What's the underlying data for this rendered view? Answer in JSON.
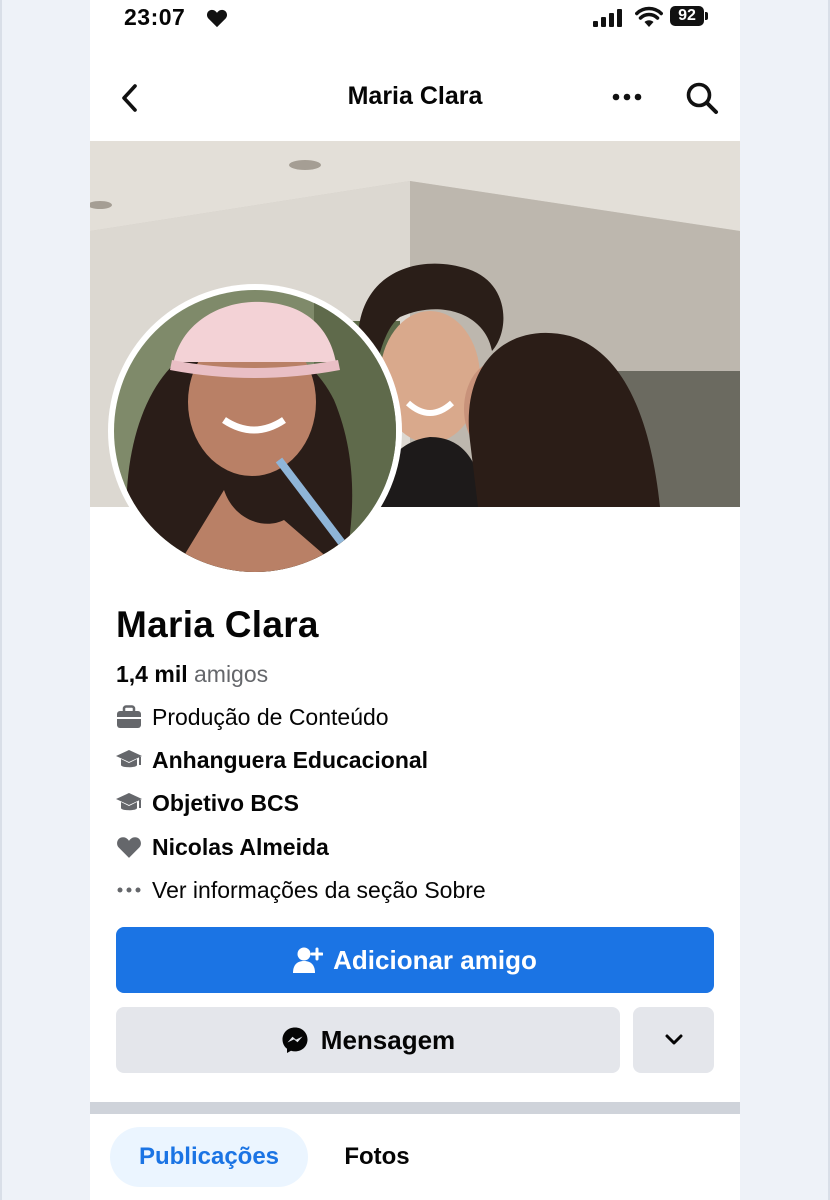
{
  "status_bar": {
    "time": "23:07",
    "battery": "92"
  },
  "header": {
    "title": "Maria Clara"
  },
  "profile": {
    "name": "Maria Clara",
    "friends_count": "1,4 mil",
    "friends_label": "amigos"
  },
  "info": [
    {
      "icon": "briefcase-icon",
      "text": "Produção de Conteúdo",
      "bold": false
    },
    {
      "icon": "graduation-cap-icon",
      "text": "Anhanguera Educacional",
      "bold": true
    },
    {
      "icon": "graduation-cap-icon",
      "text": "Objetivo BCS",
      "bold": true
    },
    {
      "icon": "heart-icon",
      "text": "Nicolas Almeida",
      "bold": true
    },
    {
      "icon": "more-dots-icon",
      "text": "Ver informações da seção Sobre",
      "bold": false
    }
  ],
  "actions": {
    "add_friend_label": "Adicionar amigo",
    "message_label": "Mensagem"
  },
  "tabs": [
    {
      "label": "Publicações",
      "active": true
    },
    {
      "label": "Fotos",
      "active": false
    }
  ],
  "colors": {
    "primary_button": "#1b74e4",
    "secondary_button": "#e4e6eb",
    "active_tab_bg": "#ebf5ff"
  }
}
